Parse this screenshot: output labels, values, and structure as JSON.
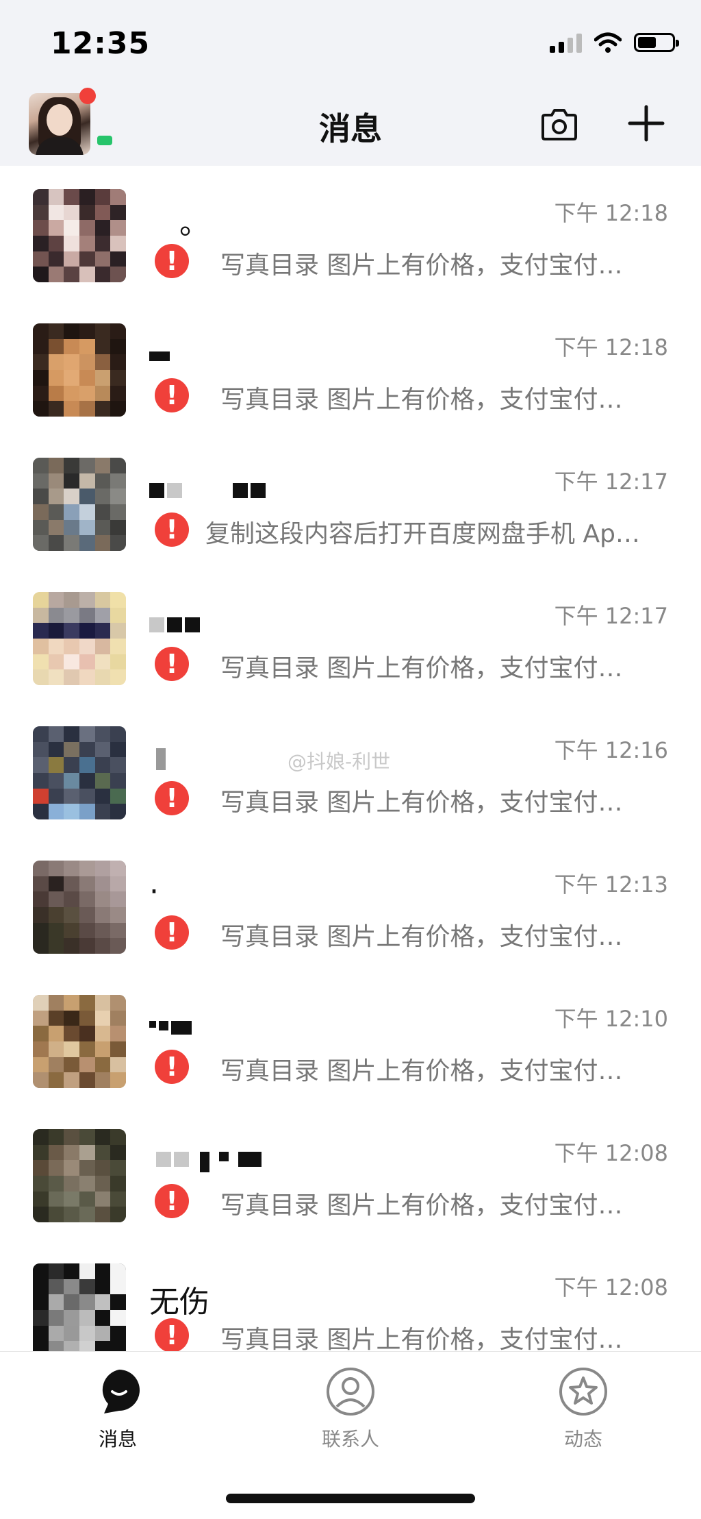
{
  "status_bar": {
    "time": "12:35"
  },
  "nav": {
    "title": "消息"
  },
  "watermark": "@抖娘-利世",
  "conversations": [
    {
      "name": "。",
      "time": "下午 12:18",
      "message": "写真目录 图片上有价格，支付宝付…"
    },
    {
      "name": "",
      "time": "下午 12:18",
      "message": "写真目录 图片上有价格，支付宝付…"
    },
    {
      "name": "",
      "time": "下午 12:17",
      "message": "复制这段内容后打开百度网盘手机 Ap…"
    },
    {
      "name": "",
      "time": "下午 12:17",
      "message": "写真目录 图片上有价格，支付宝付…"
    },
    {
      "name": "",
      "time": "下午 12:16",
      "message": "写真目录 图片上有价格，支付宝付…"
    },
    {
      "name": "·",
      "time": "下午 12:13",
      "message": "写真目录 图片上有价格，支付宝付…"
    },
    {
      "name": "",
      "time": "下午 12:10",
      "message": "写真目录 图片上有价格，支付宝付…"
    },
    {
      "name": "",
      "time": "下午 12:08",
      "message": "写真目录 图片上有价格，支付宝付…"
    },
    {
      "name": "无伤",
      "time": "下午 12:08",
      "message": "写真目录 图片上有价格，支付宝付…"
    }
  ],
  "tabs": [
    {
      "label": "消息",
      "icon": "chat-bubble-icon",
      "active": true
    },
    {
      "label": "联系人",
      "icon": "person-icon",
      "active": false
    },
    {
      "label": "动态",
      "icon": "star-icon",
      "active": false
    }
  ],
  "colors": {
    "alert": "#f0403a",
    "online": "#27c46b",
    "header_bg": "#f2f3f7"
  }
}
